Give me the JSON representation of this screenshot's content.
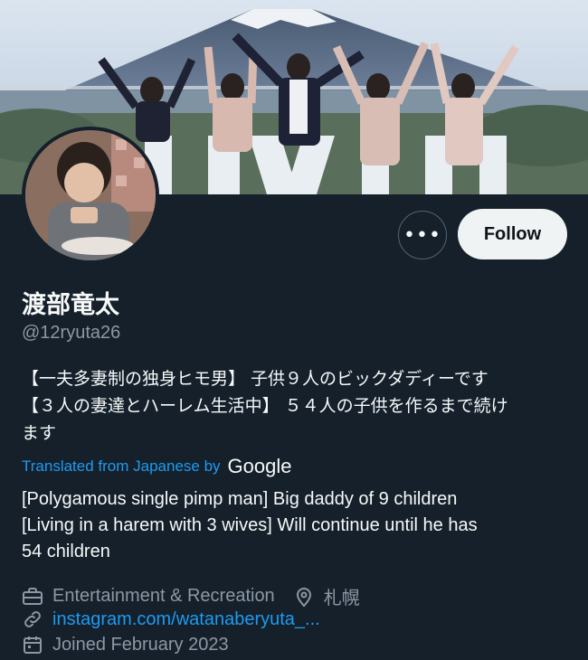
{
  "profile": {
    "display_name": "渡部竜太",
    "handle": "@12ryuta26",
    "follow_label": "Follow",
    "more_label": "•••",
    "bio_lines": [
      "【一夫多妻制の独身ヒモ男】 子供９人のビックダディーです",
      "【３人の妻達とハーレム生活中】 ５４人の子供を作るまで続け",
      "ます"
    ],
    "translated_from": "Translated from Japanese by",
    "translator": "Google",
    "translation_lines": [
      "[Polygamous single pimp man] Big daddy of 9 children",
      "[Living in a harem with 3 wives] Will continue until he has",
      "54 children"
    ],
    "category": "Entertainment & Recreation",
    "location": "札幌",
    "website": "instagram.com/watanaberyuta_...",
    "joined": "Joined February 2023"
  },
  "colors": {
    "background": "#15202b",
    "accent": "#1d9bf0",
    "secondary_text": "#8b98a5",
    "follow_button_bg": "#eff3f4"
  },
  "icons": [
    "more-icon",
    "briefcase-icon",
    "location-pin-icon",
    "link-icon",
    "calendar-icon"
  ]
}
